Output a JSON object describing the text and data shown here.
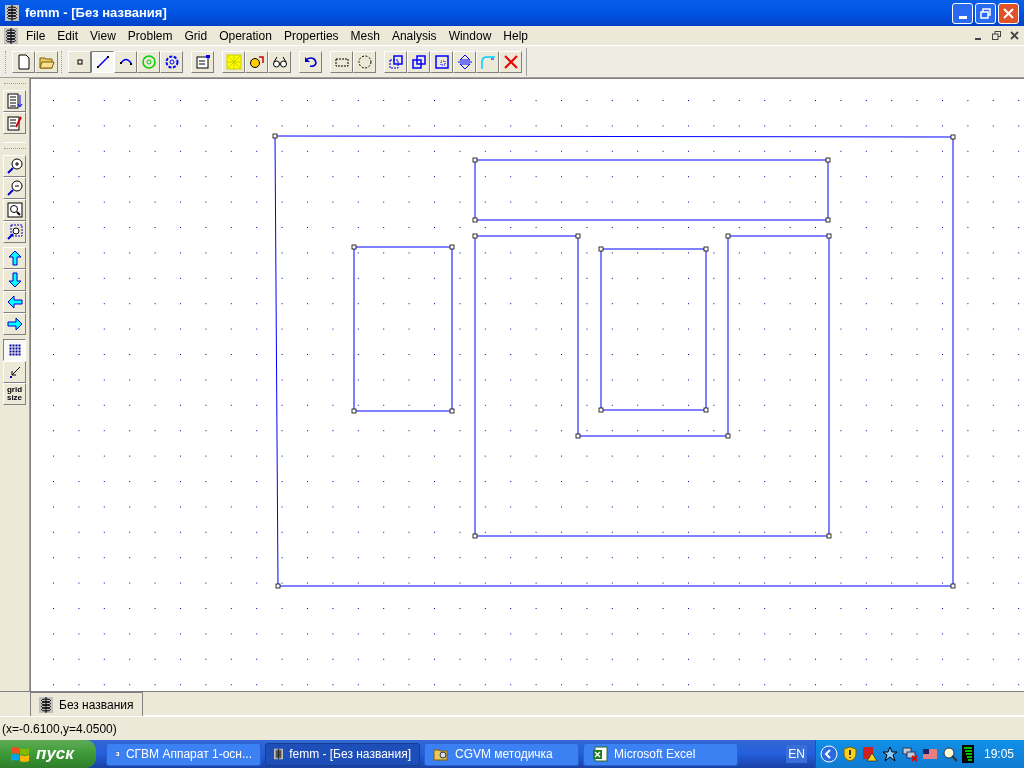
{
  "window": {
    "title": "femm - [Без названия]"
  },
  "menu": [
    "File",
    "Edit",
    "View",
    "Problem",
    "Grid",
    "Operation",
    "Properties",
    "Mesh",
    "Analysis",
    "Window",
    "Help"
  ],
  "toolbar": {
    "groups": [
      [
        {
          "kind": "new",
          "selected": false
        },
        {
          "kind": "open",
          "selected": false
        }
      ],
      [
        {
          "kind": "node",
          "selected": false
        },
        {
          "kind": "segment",
          "selected": true
        },
        {
          "kind": "arc",
          "selected": false
        },
        {
          "kind": "block",
          "selected": false
        },
        {
          "kind": "group",
          "selected": false
        }
      ],
      [
        {
          "kind": "properties",
          "selected": false
        }
      ],
      [
        {
          "kind": "mesh",
          "selected": false
        },
        {
          "kind": "analyze",
          "selected": false
        },
        {
          "kind": "results",
          "selected": false
        }
      ],
      [
        {
          "kind": "undo",
          "selected": false
        }
      ],
      [
        {
          "kind": "select-box",
          "selected": false
        },
        {
          "kind": "select-circle",
          "selected": false
        }
      ],
      [
        {
          "kind": "move",
          "selected": false
        },
        {
          "kind": "copy",
          "selected": false
        },
        {
          "kind": "scale",
          "selected": false
        },
        {
          "kind": "mirror",
          "selected": false
        },
        {
          "kind": "fillet",
          "selected": false
        },
        {
          "kind": "delete",
          "selected": false
        }
      ]
    ]
  },
  "side_toolbar": {
    "groups": [
      [
        {
          "kind": "list",
          "selected": false
        },
        {
          "kind": "notes",
          "selected": false
        }
      ],
      [
        {
          "kind": "zoom-in",
          "selected": false
        },
        {
          "kind": "zoom-out",
          "selected": false
        },
        {
          "kind": "zoom-fit",
          "selected": false
        },
        {
          "kind": "zoom-window",
          "selected": false
        },
        {
          "kind": "up",
          "selected": false
        },
        {
          "kind": "down",
          "selected": false
        },
        {
          "kind": "left",
          "selected": false
        },
        {
          "kind": "right",
          "selected": false
        },
        {
          "kind": "show-grid",
          "selected": true
        },
        {
          "kind": "snap-grid",
          "selected": false
        },
        {
          "kind": "grid-size",
          "selected": false,
          "label": "grid size"
        }
      ]
    ]
  },
  "document_tab": {
    "label": "Без названия",
    "selected": true
  },
  "status_bar": "(x=-0.6100,y=4.0500)",
  "taskbar": {
    "start": "пуск",
    "items": [
      {
        "kind": "word",
        "label": "СГВМ Аппарат 1-осн...",
        "selected": false
      },
      {
        "kind": "femm",
        "label": "femm - [Без названия]",
        "selected": true
      },
      {
        "kind": "folder",
        "label": "CGVM методичка",
        "selected": false
      },
      {
        "kind": "excel",
        "label": "Microsoft Excel",
        "selected": false
      }
    ],
    "language": "EN",
    "clock": "19:05"
  }
}
